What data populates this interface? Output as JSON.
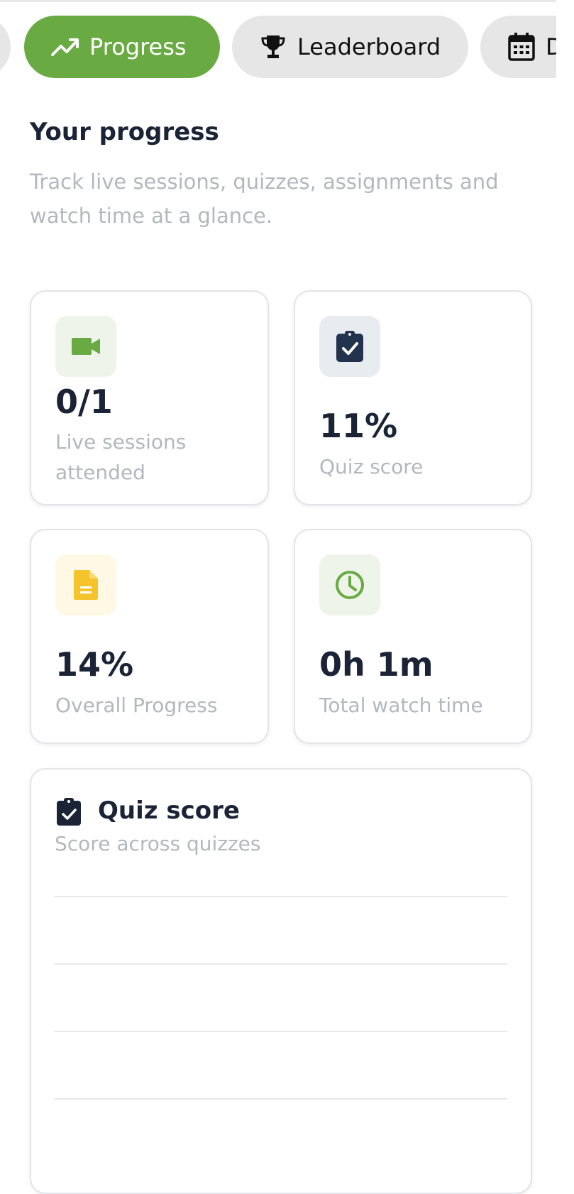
{
  "tabs": {
    "prev_label": "",
    "progress_label": "Progress",
    "leaderboard_label": "Leaderboard",
    "next_label": "D",
    "active": "Progress"
  },
  "header": {
    "title": "Your progress",
    "subtitle": "Track live sessions, quizzes, assignments and watch time at a glance."
  },
  "stats": [
    {
      "value": "0/1",
      "label": "Live sessions attended",
      "icon": "video-camera-icon",
      "color": "#6aaa43"
    },
    {
      "value": "11%",
      "label": "Quiz score",
      "icon": "clipboard-check-icon",
      "color": "#23324d"
    },
    {
      "value": "14%",
      "label": "Overall Progress",
      "icon": "document-icon",
      "color": "#f5c42c"
    },
    {
      "value": "0h 1m",
      "label": "Total watch time",
      "icon": "clock-icon",
      "color": "#6aaa43"
    }
  ],
  "quiz_chart": {
    "title": "Quiz score",
    "subtitle": "Score across quizzes",
    "icon": "clipboard-check-icon"
  },
  "colors": {
    "accent": "#6aaa43",
    "navy": "#23324d",
    "yellow": "#f5c42c",
    "muted_text": "#b4b7bd"
  }
}
